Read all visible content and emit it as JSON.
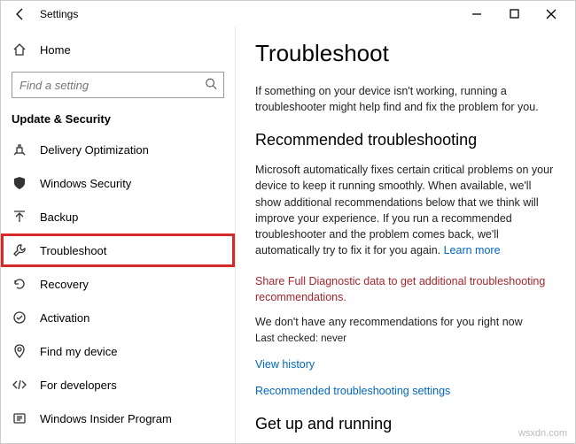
{
  "titlebar": {
    "title": "Settings"
  },
  "sidebar": {
    "home": "Home",
    "search_placeholder": "Find a setting",
    "section": "Update & Security",
    "items": [
      {
        "label": "Delivery Optimization"
      },
      {
        "label": "Windows Security"
      },
      {
        "label": "Backup"
      },
      {
        "label": "Troubleshoot"
      },
      {
        "label": "Recovery"
      },
      {
        "label": "Activation"
      },
      {
        "label": "Find my device"
      },
      {
        "label": "For developers"
      },
      {
        "label": "Windows Insider Program"
      }
    ]
  },
  "main": {
    "heading": "Troubleshoot",
    "intro": "If something on your device isn't working, running a troubleshooter might help find and fix the problem for you.",
    "rec_heading": "Recommended troubleshooting",
    "rec_body": "Microsoft automatically fixes certain critical problems on your device to keep it running smoothly. When available, we'll show additional recommendations below that we think will improve your experience. If you run a recommended troubleshooter and the problem comes back, we'll automatically try to fix it for you again. ",
    "learn_more": "Learn more",
    "diag_error": "Share Full Diagnostic data to get additional troubleshooting recommendations.",
    "no_recs": "We don't have any recommendations for you right now",
    "last_checked": "Last checked: never",
    "view_history": "View history",
    "rec_settings": "Recommended troubleshooting settings",
    "getup_heading": "Get up and running"
  },
  "watermark": "wsxdn.com"
}
